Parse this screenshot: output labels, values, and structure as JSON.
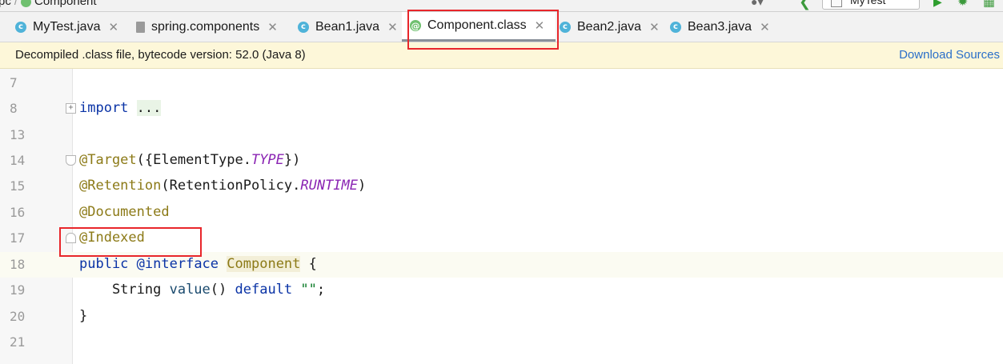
{
  "breadcrumb": {
    "parent": "pc",
    "separator": "/",
    "current": "Component"
  },
  "toolbar": {
    "run_config": "MyTest"
  },
  "tabs": [
    {
      "label": "MyTest.java",
      "icon": "c"
    },
    {
      "label": "spring.components",
      "icon": "file"
    },
    {
      "label": "Bean1.java",
      "icon": "c"
    },
    {
      "label": "Component.class",
      "icon": "@"
    },
    {
      "label": "Bean2.java",
      "icon": "c"
    },
    {
      "label": "Bean3.java",
      "icon": "c"
    }
  ],
  "banner": {
    "message": "Decompiled .class file, bytecode version: 52.0 (Java 8)",
    "link": "Download Sources"
  },
  "editor": {
    "lines": [
      {
        "num": "7"
      },
      {
        "num": "8",
        "t1": "import",
        "t2": " ",
        "t3": "..."
      },
      {
        "num": "13"
      },
      {
        "num": "14",
        "t1": "@Target",
        "t2": "({ElementType.",
        "t3": "TYPE",
        "t4": "})"
      },
      {
        "num": "15",
        "t1": "@Retention",
        "t2": "(RetentionPolicy.",
        "t3": "RUNTIME",
        "t4": ")"
      },
      {
        "num": "16",
        "t1": "@Documented"
      },
      {
        "num": "17",
        "t1": "@Indexed"
      },
      {
        "num": "18",
        "t1": "public",
        "t2": " @",
        "t3": "interface",
        "t4": " ",
        "t5": "Component",
        "t6": " {"
      },
      {
        "num": "19",
        "t1": "    String ",
        "t2": "value",
        "t3": "() ",
        "t4": "default",
        "t5": " ",
        "t6": "\"\"",
        "t7": ";"
      },
      {
        "num": "20",
        "t1": "}"
      },
      {
        "num": "21"
      }
    ]
  },
  "colors": {
    "highlight": "#e8262b",
    "banner_bg": "#fdf7d9",
    "link": "#2a6fc9"
  }
}
